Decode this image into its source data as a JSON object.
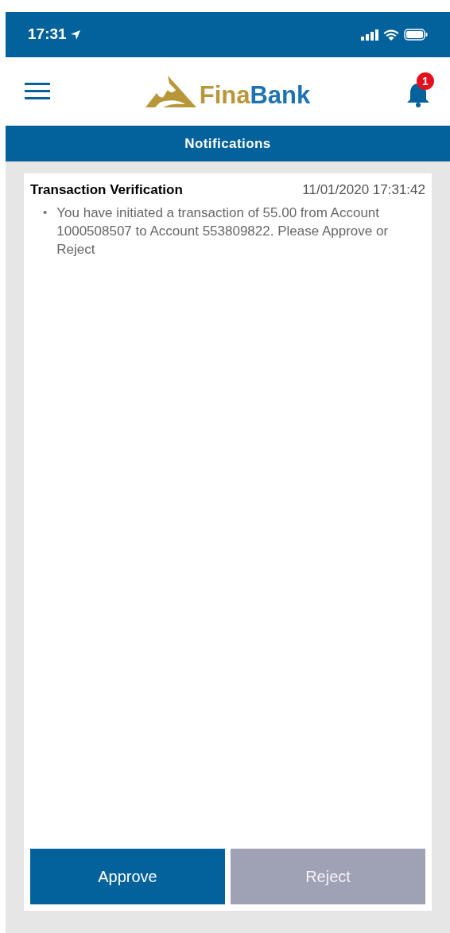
{
  "status_bar": {
    "time": "17:31"
  },
  "header": {
    "brand": {
      "first": "Fina",
      "second": "Bank"
    },
    "notification_count": "1"
  },
  "title_bar": {
    "title": "Notifications"
  },
  "notifications": [
    {
      "title": "Transaction Verification",
      "timestamp": "11/01/2020 17:31:42",
      "bullet": "•",
      "message": "You have initiated a transaction of 55.00 from Account 1000508507 to Account 553809822. Please Approve or Reject"
    }
  ],
  "actions": [
    {
      "label": "Approve",
      "disabled": false
    },
    {
      "label": "Reject",
      "disabled": true
    }
  ]
}
